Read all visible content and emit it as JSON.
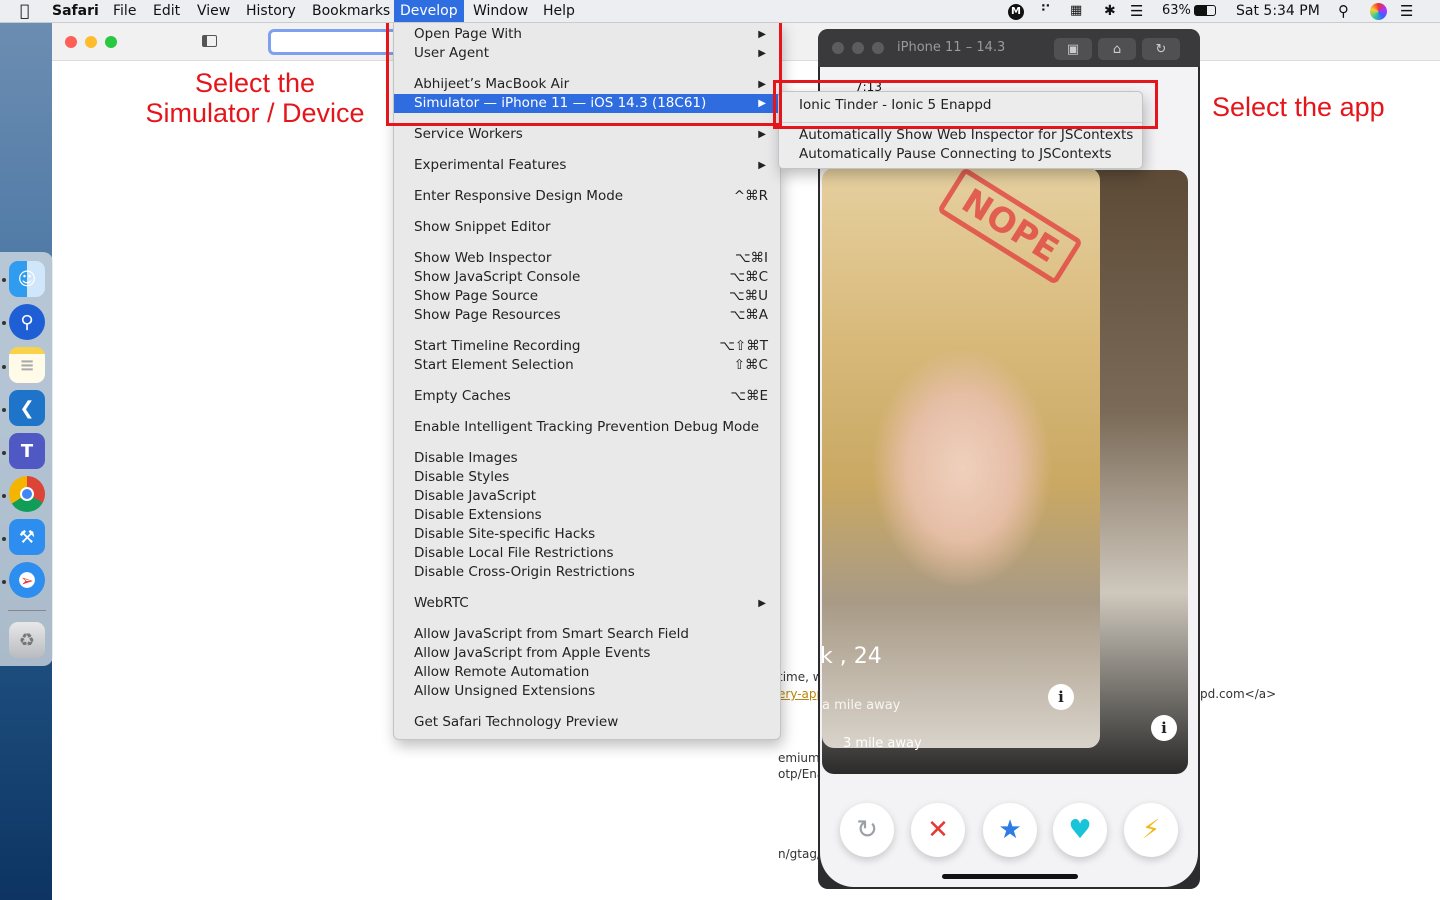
{
  "menubar": {
    "apple": "",
    "app": "Safari",
    "items": [
      "File",
      "Edit",
      "View",
      "History",
      "Bookmarks",
      "Develop",
      "Window",
      "Help"
    ],
    "tray": {
      "battery": "63%",
      "clock": "Sat 5:34 PM"
    }
  },
  "develop_menu": {
    "items": [
      {
        "label": "Open Page With",
        "shortcut": "",
        "submenu": true
      },
      {
        "label": "User Agent",
        "shortcut": "",
        "submenu": true
      },
      {
        "label": "Abhijeet’s MacBook Air",
        "shortcut": "",
        "submenu": true
      },
      {
        "label": "Simulator — iPhone 11 — iOS 14.3 (18C61)",
        "shortcut": "",
        "submenu": true,
        "highlighted": true
      },
      {
        "label": "Service Workers",
        "shortcut": "",
        "submenu": true
      },
      {
        "label": "Experimental Features",
        "shortcut": "",
        "submenu": true
      },
      {
        "label": "Enter Responsive Design Mode",
        "shortcut": "^⌘R"
      },
      {
        "label": "Show Snippet Editor",
        "shortcut": ""
      },
      {
        "label": "Show Web Inspector",
        "shortcut": "⌥⌘I"
      },
      {
        "label": "Show JavaScript Console",
        "shortcut": "⌥⌘C"
      },
      {
        "label": "Show Page Source",
        "shortcut": "⌥⌘U"
      },
      {
        "label": "Show Page Resources",
        "shortcut": "⌥⌘A"
      },
      {
        "label": "Start Timeline Recording",
        "shortcut": "⌥⇧⌘T"
      },
      {
        "label": "Start Element Selection",
        "shortcut": "⇧⌘C"
      },
      {
        "label": "Empty Caches",
        "shortcut": "⌥⌘E"
      },
      {
        "label": "Enable Intelligent Tracking Prevention Debug Mode",
        "shortcut": ""
      },
      {
        "label": "Disable Images",
        "shortcut": ""
      },
      {
        "label": "Disable Styles",
        "shortcut": ""
      },
      {
        "label": "Disable JavaScript",
        "shortcut": ""
      },
      {
        "label": "Disable Extensions",
        "shortcut": ""
      },
      {
        "label": "Disable Site-specific Hacks",
        "shortcut": ""
      },
      {
        "label": "Disable Local File Restrictions",
        "shortcut": ""
      },
      {
        "label": "Disable Cross-Origin Restrictions",
        "shortcut": ""
      },
      {
        "label": "WebRTC",
        "shortcut": "",
        "submenu": true
      },
      {
        "label": "Allow JavaScript from Smart Search Field",
        "shortcut": ""
      },
      {
        "label": "Allow JavaScript from Apple Events",
        "shortcut": ""
      },
      {
        "label": "Allow Remote Automation",
        "shortcut": ""
      },
      {
        "label": "Allow Unsigned Extensions",
        "shortcut": ""
      },
      {
        "label": "Get Safari Technology Preview",
        "shortcut": ""
      }
    ]
  },
  "simulator_submenu": {
    "items": [
      "Ionic Tinder - Ionic 5 Enappd",
      "Automatically Show Web Inspector for JSContexts",
      "Automatically Pause Connecting to JSContexts"
    ]
  },
  "simulator_window": {
    "title": "iPhone 11 – 14.3",
    "status_time": "7:13",
    "card_name": "k , 24",
    "card_distance_front": "a mile away",
    "card_distance_back": "3 mile away",
    "stamp": "NOPE"
  },
  "background_page": {
    "fragments": [
      "time, w",
      "ery-app",
      "pd.com</a>",
      "emium\"",
      "otp/Ena",
      "n/gtag/"
    ]
  },
  "annotations": {
    "left": [
      "Select the",
      "Simulator / Device"
    ],
    "right": "Select the app"
  },
  "colors": {
    "annotation": "#e4161b",
    "highlight": "#2f6cdf"
  }
}
